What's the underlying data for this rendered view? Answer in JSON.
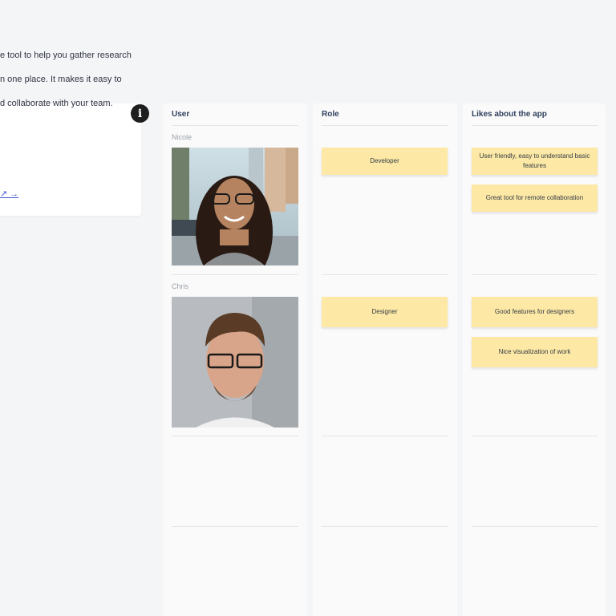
{
  "info_card": {
    "text_lines": [
      "e tool to help you gather research",
      "n one place. It makes it easy to",
      "d collaborate with your team."
    ],
    "link_text": "↗ →",
    "info_icon": "info-icon"
  },
  "columns": {
    "user": {
      "header": "User"
    },
    "role": {
      "header": "Role"
    },
    "likes": {
      "header": "Likes about the app"
    }
  },
  "rows": [
    {
      "name": "Nicole",
      "role": "Developer",
      "likes": [
        "User friendly, easy to understand basic features",
        "Great tool for remote collaboration"
      ]
    },
    {
      "name": "Chris",
      "role": "Designer",
      "likes": [
        "Good features for designers",
        "Nice visualization of work"
      ]
    }
  ],
  "colors": {
    "background": "#f4f5f7",
    "note": "#fde9a5",
    "header_text": "#2e3f5c",
    "link": "#4a5bd6"
  }
}
